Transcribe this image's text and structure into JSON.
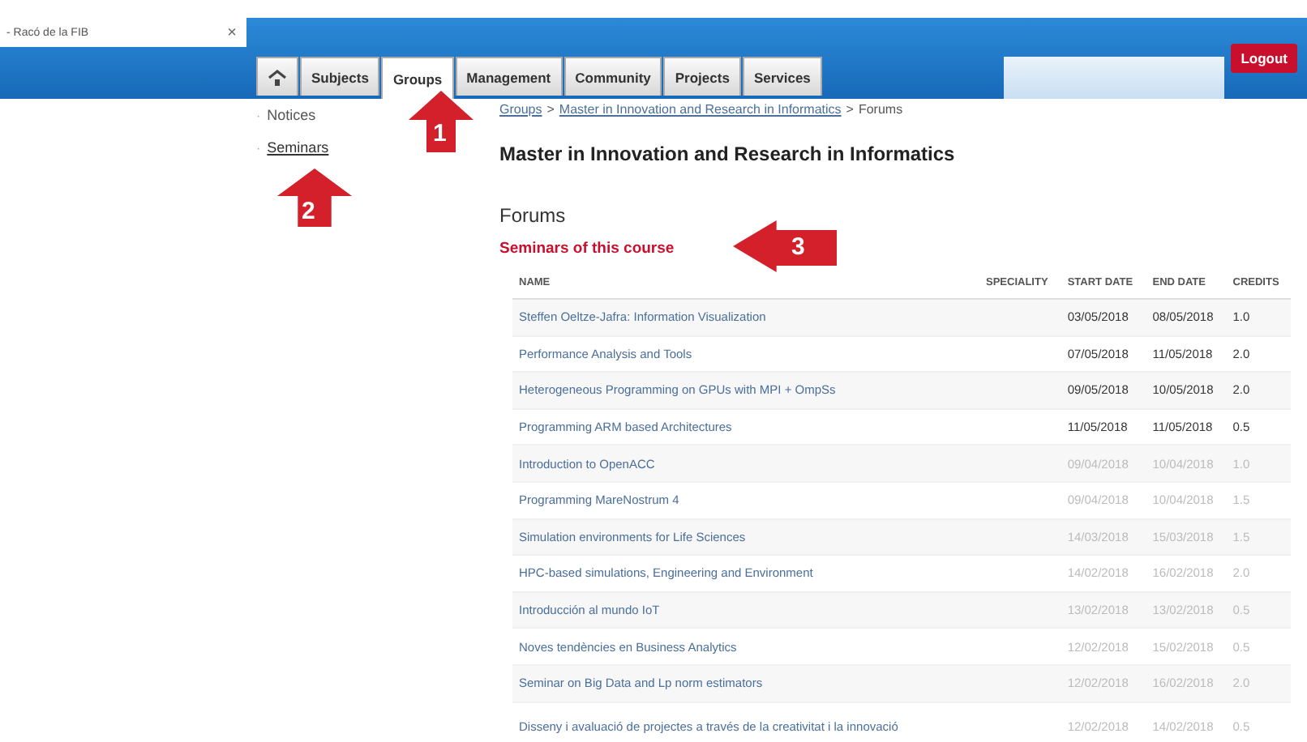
{
  "browser_tab": {
    "title": "- Racó de la FIB",
    "close": "×"
  },
  "nav": {
    "tabs": [
      {
        "kind": "home",
        "selected": false
      },
      {
        "kind": "text",
        "label": "Subjects",
        "selected": false
      },
      {
        "kind": "text",
        "label": "Groups",
        "selected": true
      },
      {
        "kind": "text",
        "label": "Management",
        "selected": false
      },
      {
        "kind": "text",
        "label": "Community",
        "selected": false
      },
      {
        "kind": "text",
        "label": "Projects",
        "selected": false
      },
      {
        "kind": "text",
        "label": "Services",
        "selected": false
      }
    ],
    "logout": "Logout"
  },
  "sidebar": {
    "items": [
      {
        "bullet": "·",
        "label": "Notices",
        "selected": false
      },
      {
        "bullet": "·",
        "label": "Seminars",
        "selected": true
      }
    ]
  },
  "breadcrumb": [
    {
      "kind": "link",
      "label": "Groups"
    },
    {
      "kind": "separator",
      "label": ">"
    },
    {
      "kind": "link",
      "label": "Master in Innovation and Research in Informatics"
    },
    {
      "kind": "separator",
      "label": ">"
    },
    {
      "kind": "current",
      "label": "Forums"
    }
  ],
  "title": "Master in Innovation and Research in Informatics",
  "section": "Forums",
  "subsection": "Seminars of this course",
  "table": {
    "columns": [
      "NAME",
      "SPECIALITY",
      "START DATE",
      "END DATE",
      "CREDITS"
    ],
    "rows": [
      {
        "name": "Steffen Oeltze-Jafra: Information Visualization",
        "start": "03/05/2018",
        "end": "08/05/2018",
        "credits": "1.0",
        "disabled": false
      },
      {
        "name": "Performance Analysis and Tools",
        "start": "07/05/2018",
        "end": "11/05/2018",
        "credits": "2.0",
        "disabled": false
      },
      {
        "name": "Heterogeneous Programming on GPUs with MPI + OmpSs",
        "start": "09/05/2018",
        "end": "10/05/2018",
        "credits": "2.0",
        "disabled": false
      },
      {
        "name": "Programming ARM based Architectures",
        "start": "11/05/2018",
        "end": "11/05/2018",
        "credits": "0.5",
        "disabled": false
      },
      {
        "name": "Introduction to OpenACC",
        "start": "09/04/2018",
        "end": "10/04/2018",
        "credits": "1.0",
        "disabled": true
      },
      {
        "name": "Programming MareNostrum 4",
        "start": "09/04/2018",
        "end": "10/04/2018",
        "credits": "1.5",
        "disabled": true
      },
      {
        "name": "Simulation environments for Life Sciences",
        "start": "14/03/2018",
        "end": "15/03/2018",
        "credits": "1.5",
        "disabled": true
      },
      {
        "name": "HPC-based simulations, Engineering and Environment",
        "start": "14/02/2018",
        "end": "16/02/2018",
        "credits": "2.0",
        "disabled": true
      },
      {
        "name": "Introducción al mundo IoT",
        "start": "13/02/2018",
        "end": "13/02/2018",
        "credits": "0.5",
        "disabled": true
      },
      {
        "name": "Noves tendències en Business Analytics",
        "start": "12/02/2018",
        "end": "15/02/2018",
        "credits": "0.5",
        "disabled": true
      },
      {
        "name": "Seminar on Big Data and Lp norm estimators",
        "start": "12/02/2018",
        "end": "16/02/2018",
        "credits": "2.0",
        "disabled": true
      },
      {
        "name": "Disseny i avaluació de projectes a través de la creativitat i la innovació",
        "start": "12/02/2018",
        "end": "14/02/2018",
        "credits": "0.5",
        "disabled": true
      }
    ]
  },
  "annotations": [
    {
      "label": "1",
      "kind": "up"
    },
    {
      "label": "2",
      "kind": "up"
    },
    {
      "label": "3",
      "kind": "left"
    }
  ]
}
